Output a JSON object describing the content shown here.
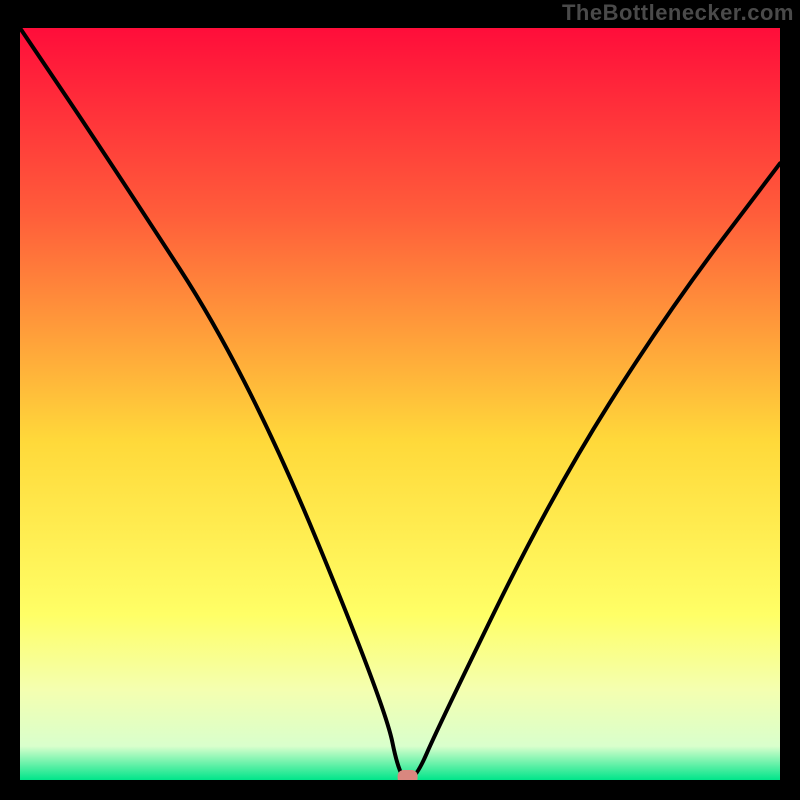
{
  "attribution": "TheBottlenecker.com",
  "chart_data": {
    "type": "line",
    "title": "",
    "xlabel": "",
    "ylabel": "",
    "xlim": [
      0,
      100
    ],
    "ylim": [
      0,
      100
    ],
    "series": [
      {
        "name": "bottleneck-curve",
        "x": [
          0,
          12,
          30,
          48,
          50,
          52,
          55,
          70,
          85,
          100
        ],
        "values": [
          100,
          82,
          54,
          10,
          0,
          0,
          7,
          38,
          62,
          82
        ]
      }
    ],
    "marker": {
      "x": 51,
      "y": 0,
      "color": "#d9877f"
    },
    "gradient_stops": [
      {
        "offset": 0.0,
        "color": "#ff0d3a"
      },
      {
        "offset": 0.25,
        "color": "#ff5e3a"
      },
      {
        "offset": 0.55,
        "color": "#ffd93a"
      },
      {
        "offset": 0.78,
        "color": "#ffff66"
      },
      {
        "offset": 0.88,
        "color": "#f4ffb0"
      },
      {
        "offset": 0.955,
        "color": "#d9ffcc"
      },
      {
        "offset": 1.0,
        "color": "#00e58a"
      }
    ]
  }
}
